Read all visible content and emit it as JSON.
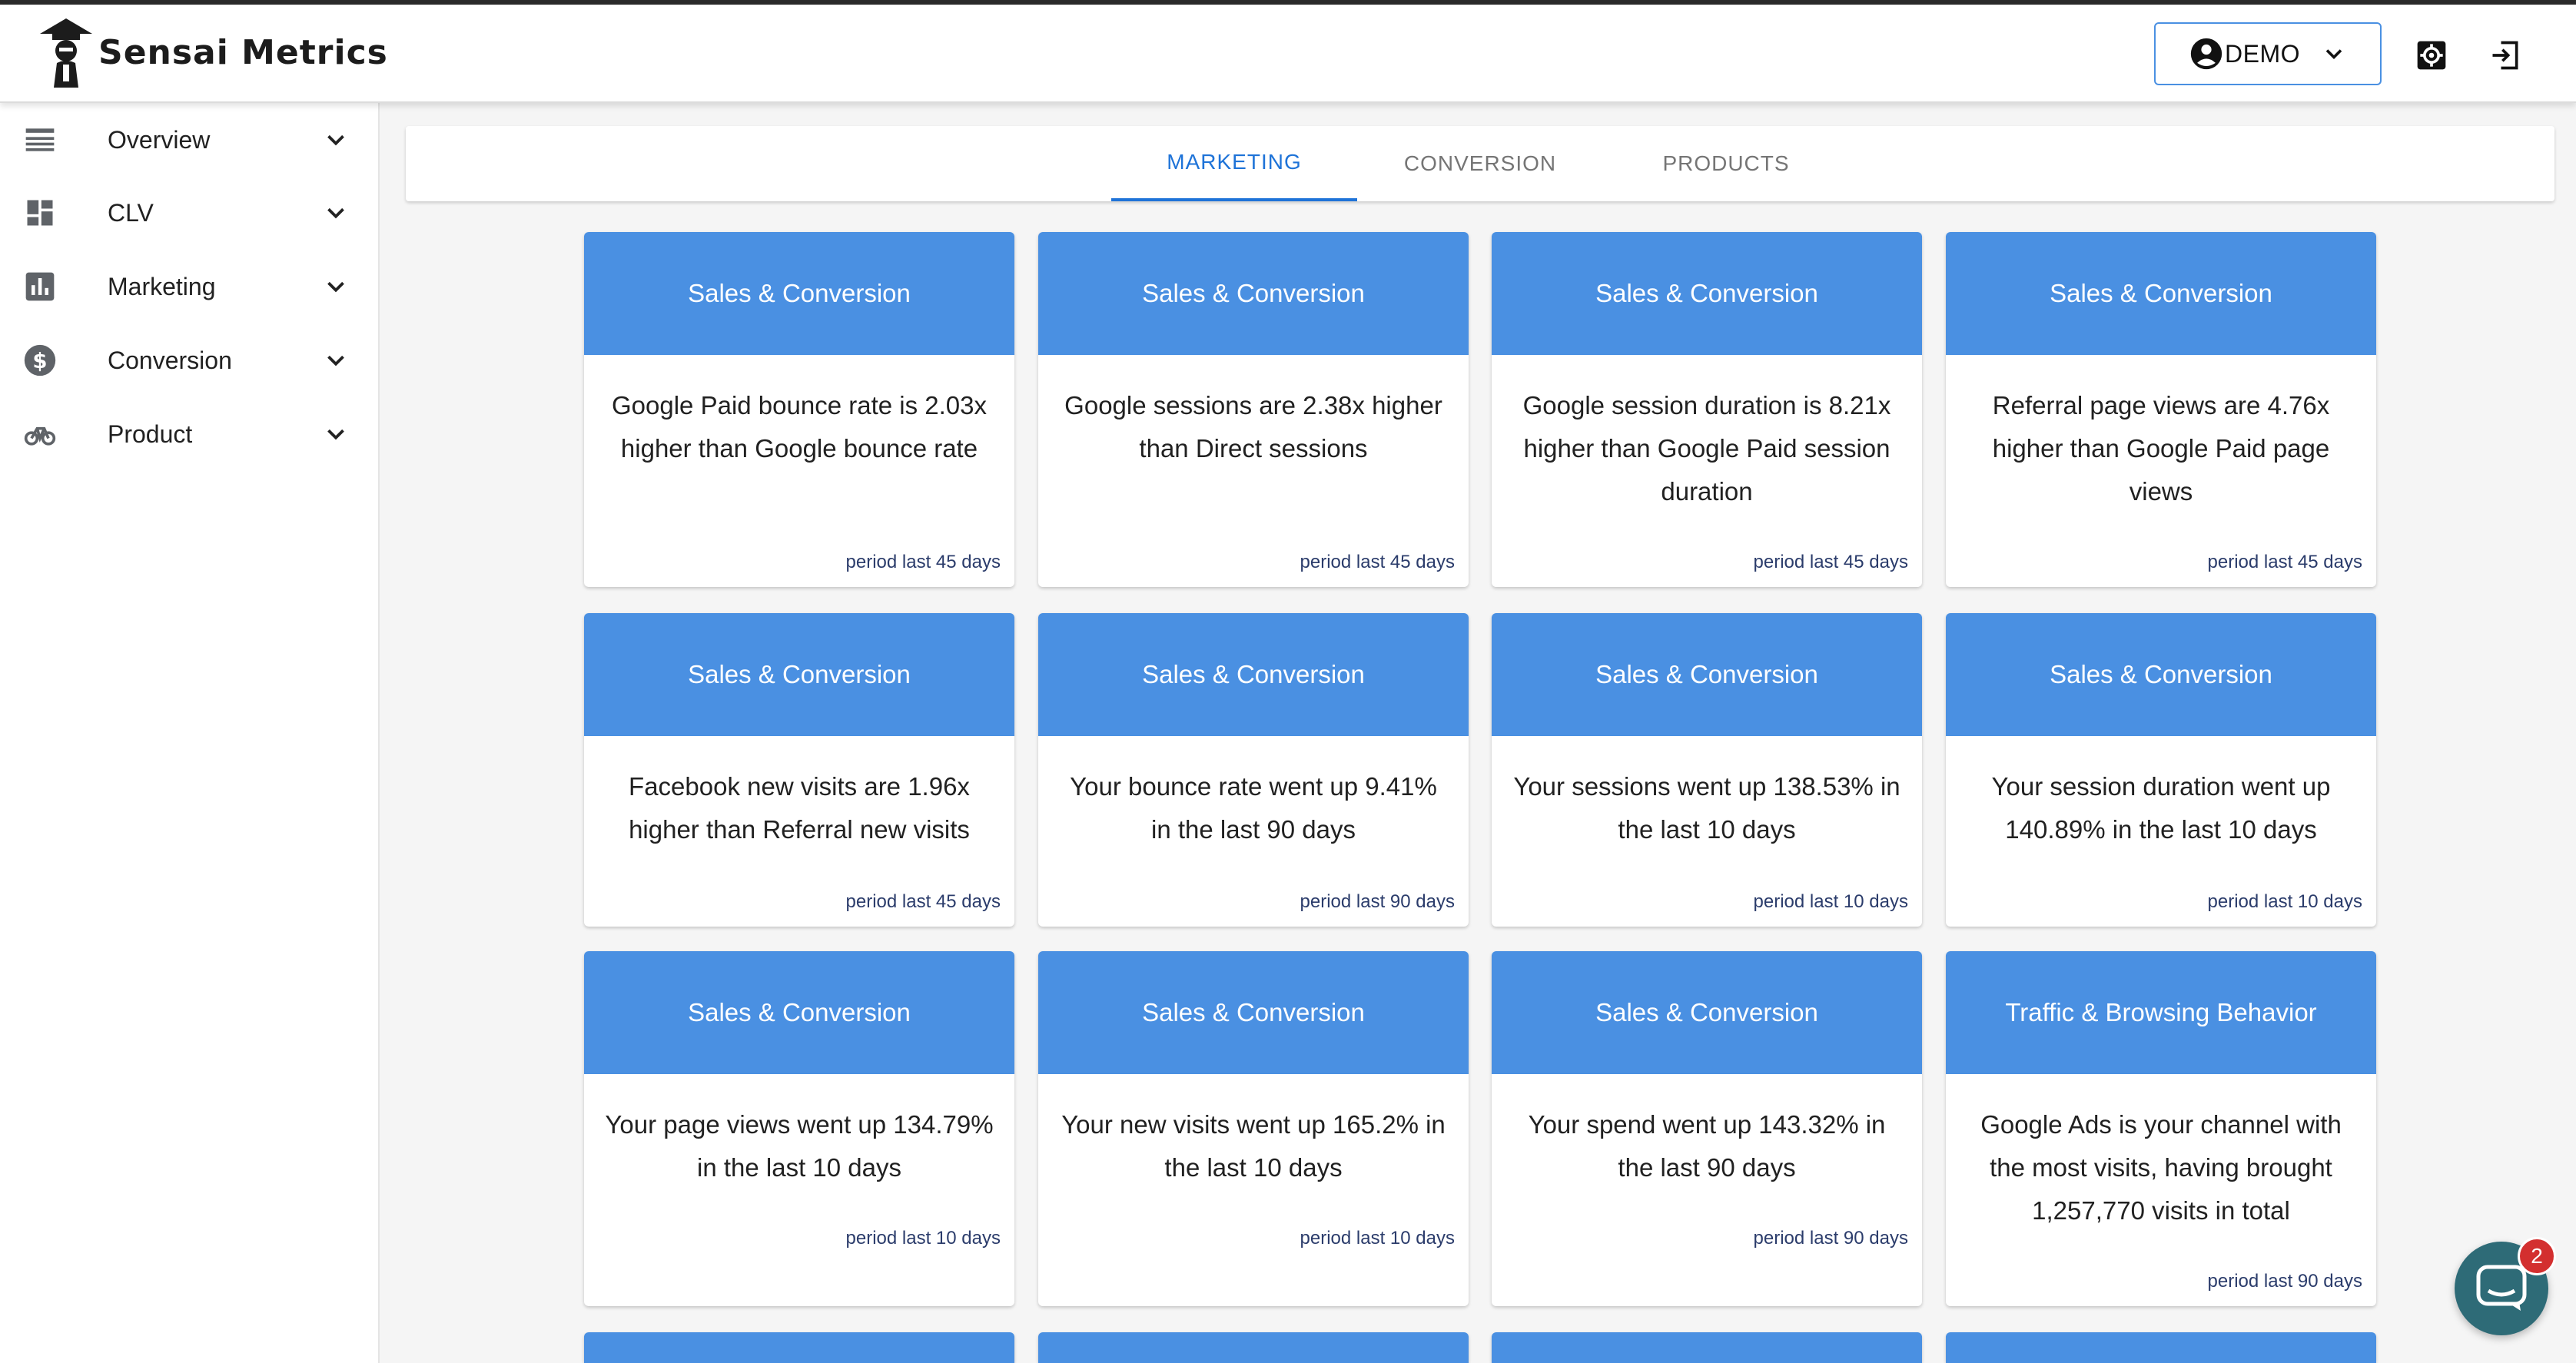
{
  "app": {
    "name": "Sensai Metrics"
  },
  "header": {
    "user_label": "DEMO"
  },
  "sidebar": {
    "items": [
      {
        "label": "Overview",
        "icon": "table-rows-icon"
      },
      {
        "label": "CLV",
        "icon": "dashboard-icon"
      },
      {
        "label": "Marketing",
        "icon": "bar-chart-icon"
      },
      {
        "label": "Conversion",
        "icon": "dollar-icon"
      },
      {
        "label": "Product",
        "icon": "bike-icon"
      }
    ]
  },
  "tabs": [
    {
      "label": "MARKETING",
      "active": true
    },
    {
      "label": "CONVERSION",
      "active": false
    },
    {
      "label": "PRODUCTS",
      "active": false
    }
  ],
  "cards": [
    {
      "category": "Sales & Conversion",
      "text": "Google Paid bounce rate is 2.03x higher than Google bounce rate",
      "period": "period last 45 days"
    },
    {
      "category": "Sales & Conversion",
      "text": "Google sessions are 2.38x higher than Direct sessions",
      "period": "period last 45 days"
    },
    {
      "category": "Sales & Conversion",
      "text": "Google session duration is 8.21x higher than Google Paid session duration",
      "period": "period last 45 days"
    },
    {
      "category": "Sales & Conversion",
      "text": "Referral page views are 4.76x higher than Google Paid page views",
      "period": "period last 45 days"
    },
    {
      "category": "Sales & Conversion",
      "text": "Facebook new visits are 1.96x higher than Referral new visits",
      "period": "period last 45 days"
    },
    {
      "category": "Sales & Conversion",
      "text": "Your bounce rate went up 9.41% in the last 90 days",
      "period": "period last 90 days"
    },
    {
      "category": "Sales & Conversion",
      "text": "Your sessions went up 138.53% in the last 10 days",
      "period": "period last 10 days"
    },
    {
      "category": "Sales & Conversion",
      "text": "Your session duration went up 140.89% in the last 10 days",
      "period": "period last 10 days"
    },
    {
      "category": "Sales & Conversion",
      "text": "Your page views went up 134.79% in the last 10 days",
      "period": "period last 10 days"
    },
    {
      "category": "Sales & Conversion",
      "text": "Your new visits went up 165.2% in the last 10 days",
      "period": "period last 10 days"
    },
    {
      "category": "Sales & Conversion",
      "text": "Your spend went up 143.32% in the last 90 days",
      "period": "period last 90 days"
    },
    {
      "category": "Traffic & Browsing Behavior",
      "text": "Google Ads is your channel with the most visits, having brought 1,257,770 visits in total",
      "period": "period last 90 days"
    }
  ],
  "chat": {
    "unread_count": "2"
  },
  "colors": {
    "accent": "#4a90e2",
    "active_tab": "#1e73d8",
    "badge": "#d32f2f",
    "chat": "#2e6b77"
  }
}
